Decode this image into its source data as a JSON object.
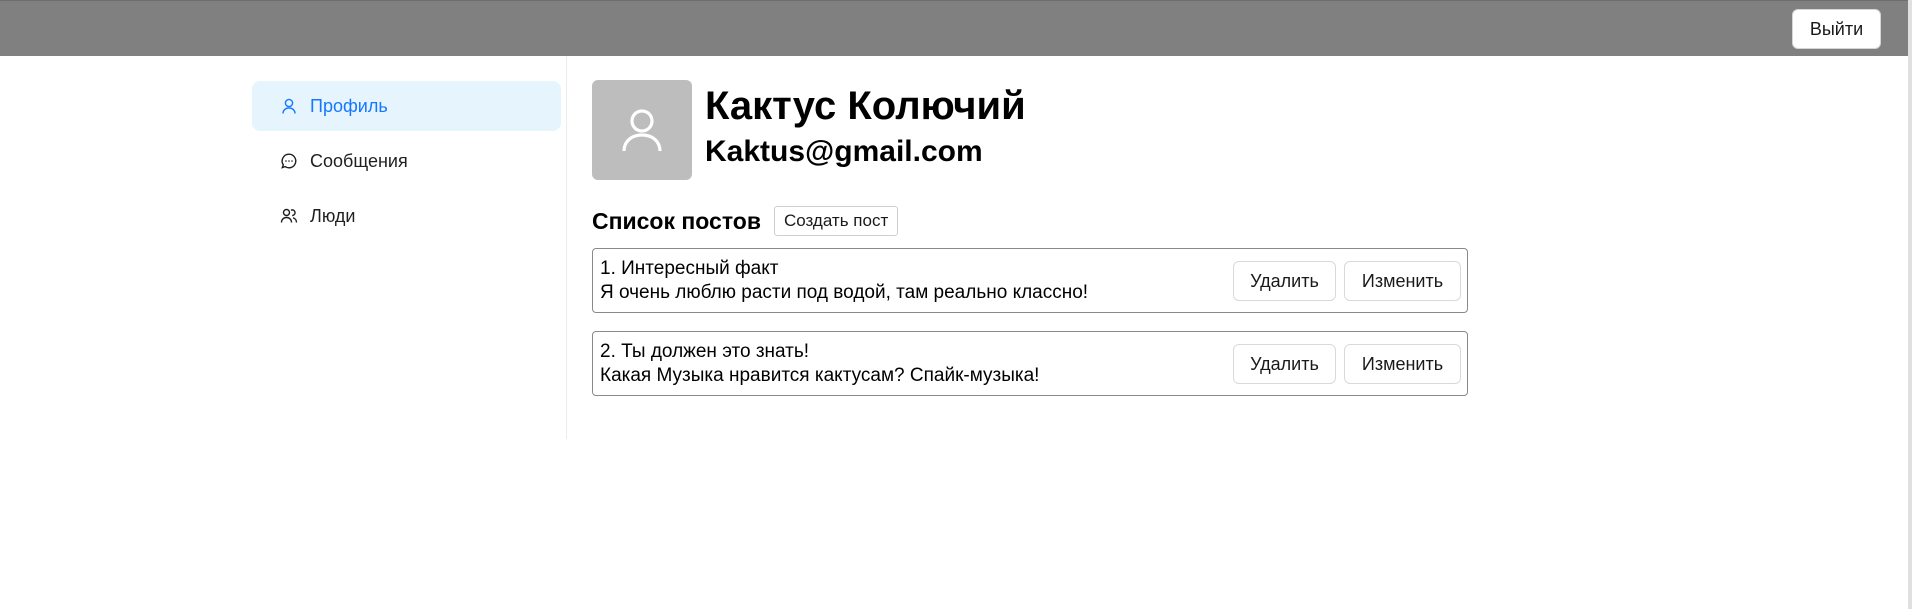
{
  "header": {
    "logout_label": "Выйти"
  },
  "sidebar": {
    "items": [
      {
        "label": "Профиль",
        "icon": "user-icon",
        "active": true
      },
      {
        "label": "Сообщения",
        "icon": "message-icon",
        "active": false
      },
      {
        "label": "Люди",
        "icon": "people-icon",
        "active": false
      }
    ]
  },
  "profile": {
    "name": "Кактус Колючий",
    "email": "Kaktus@gmail.com",
    "avatar_icon": "avatar-placeholder-icon"
  },
  "posts": {
    "title": "Список постов",
    "create_label": "Создать пост",
    "delete_label": "Удалить",
    "edit_label": "Изменить",
    "items": [
      {
        "title": "1. Интересный факт",
        "body": "Я очень люблю расти под водой, там реально классно!"
      },
      {
        "title": "2. Ты должен это знать!",
        "body": "Какая Музыка нравится кактусам? Спайк-музыка!"
      }
    ]
  },
  "colors": {
    "topbar": "#808080",
    "active_bg": "#e6f4fe",
    "active_text": "#1677ff",
    "avatar_bg": "#bdbdbd"
  }
}
